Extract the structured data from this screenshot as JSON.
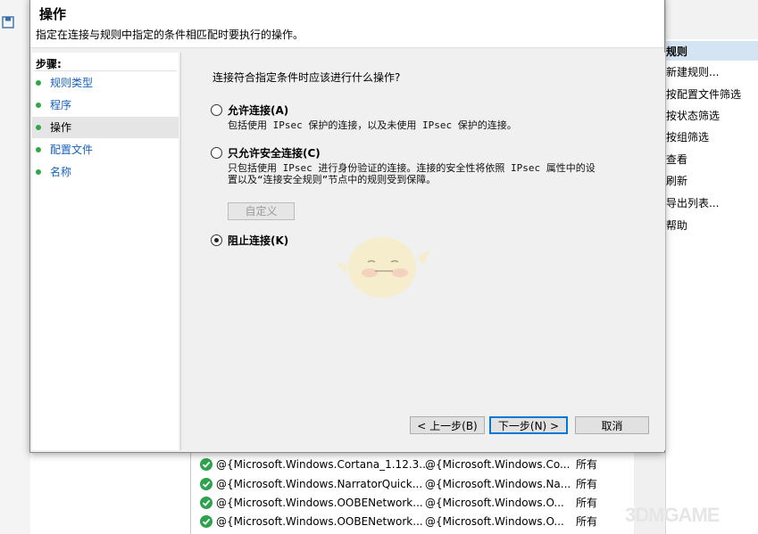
{
  "actions_panel": {
    "header": "规则",
    "items": [
      "新建规则...",
      "按配置文件筛选",
      "按状态筛选",
      "按组筛选",
      "查看",
      "刷新",
      "导出列表...",
      "帮助"
    ]
  },
  "rules_table": {
    "rows": [
      {
        "name": "@{Microsoft.Windows.Cortana_1.12.3...",
        "group": "@{Microsoft.Windows.Co...",
        "profile": "所有"
      },
      {
        "name": "@{Microsoft.Windows.NarratorQuick...",
        "group": "@{Microsoft.Windows.Na...",
        "profile": "所有"
      },
      {
        "name": "@{Microsoft.Windows.OOBENetwork...",
        "group": "@{Microsoft.Windows.O...",
        "profile": "所有"
      },
      {
        "name": "@{Microsoft.Windows.OOBENetwork...",
        "group": "@{Microsoft.Windows.O...",
        "profile": "所有"
      }
    ]
  },
  "dialog": {
    "title": "操作",
    "subtitle": "指定在连接与规则中指定的条件相匹配时要执行的操作。",
    "steps_header": "步骤:",
    "steps": [
      {
        "label": "规则类型",
        "active": false
      },
      {
        "label": "程序",
        "active": false
      },
      {
        "label": "操作",
        "active": true
      },
      {
        "label": "配置文件",
        "active": false
      },
      {
        "label": "名称",
        "active": false
      }
    ],
    "question": "连接符合指定条件时应该进行什么操作?",
    "options": {
      "allow": {
        "label": "允许连接(A)",
        "desc": "包括使用 IPsec 保护的连接，以及未使用 IPsec 保护的连接。",
        "selected": false
      },
      "allow_secure": {
        "label": "只允许安全连接(C)",
        "desc_line1": "只包括使用 IPsec 进行身份验证的连接。连接的安全性将依照 IPsec 属性中的设",
        "desc_line2": "置以及“连接安全规则”节点中的规则受到保障。",
        "selected": false
      },
      "block": {
        "label": "阻止连接(K)",
        "selected": true
      }
    },
    "customize_label": "自定义",
    "buttons": {
      "back": "< 上一步(B)",
      "next": "下一步(N) >",
      "cancel": "取消"
    }
  },
  "watermark": "3DMGAME",
  "colors": {
    "accent": "#0078d7",
    "step_link": "#1560bd",
    "step_dot": "#2fa745",
    "rule_enabled": "#2ca34c",
    "actions_header_bg": "#d5e4f3"
  }
}
